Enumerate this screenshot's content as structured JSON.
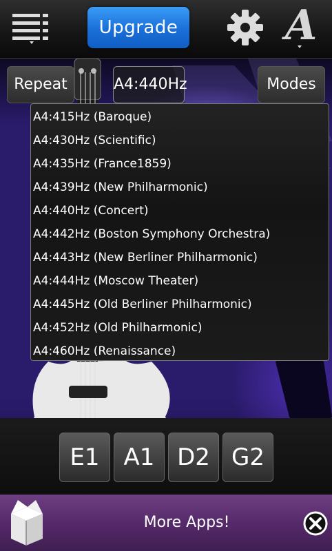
{
  "header": {
    "upgrade_label": "Upgrade",
    "icons": [
      "menu-icon",
      "gear-icon",
      "font-icon"
    ],
    "font_icon_glyph": "A"
  },
  "controls": {
    "repeat_label": "Repeat",
    "pitch_label": "A4:440Hz",
    "modes_label": "Modes"
  },
  "pitch_options": [
    "A4:415Hz (Baroque)",
    "A4:430Hz (Scientific)",
    "A4:435Hz (France1859)",
    "A4:439Hz (New Philharmonic)",
    "A4:440Hz (Concert)",
    "A4:442Hz (Boston Symphony Orchestra)",
    "A4:443Hz (New Berliner Philharmonic)",
    "A4:444Hz (Moscow Theater)",
    "A4:445Hz (Old Berliner Philharmonic)",
    "A4:452Hz (Old Philharmonic)",
    "A4:460Hz (Renaissance)"
  ],
  "strings": [
    "E1",
    "A1",
    "D2",
    "G2"
  ],
  "ad": {
    "text": "More Apps!"
  },
  "colors": {
    "upgrade_blue": "#1a6fd8",
    "ad_purple": "#562a6a",
    "scene_purple": "#2a1b6b"
  }
}
